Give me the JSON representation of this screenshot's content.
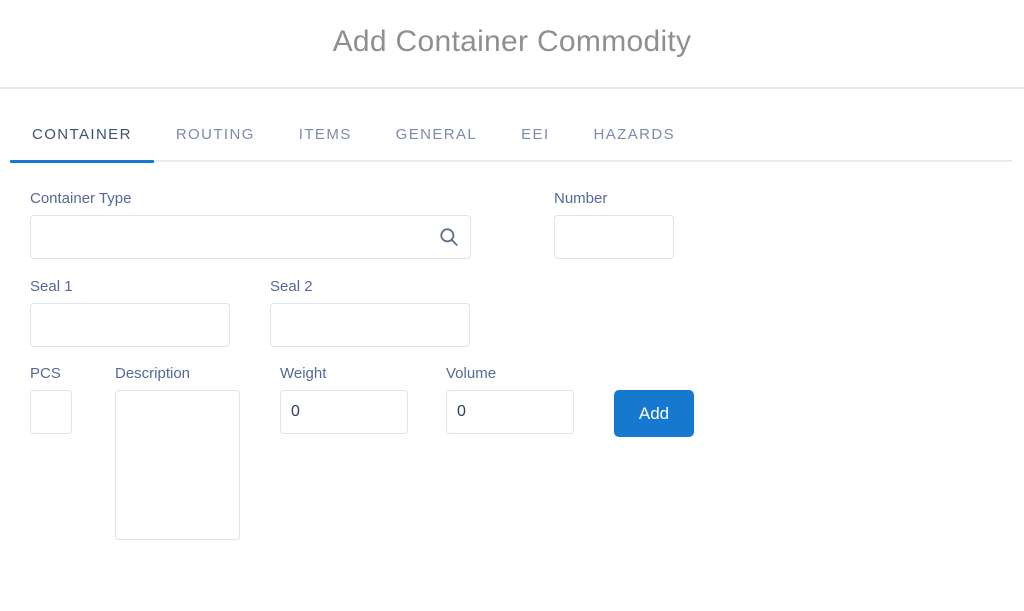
{
  "header": {
    "title": "Add Container Commodity"
  },
  "tabs": [
    {
      "label": "CONTAINER",
      "active": true
    },
    {
      "label": "ROUTING",
      "active": false
    },
    {
      "label": "ITEMS",
      "active": false
    },
    {
      "label": "GENERAL",
      "active": false
    },
    {
      "label": "EEI",
      "active": false
    },
    {
      "label": "HAZARDS",
      "active": false
    }
  ],
  "form": {
    "container_type": {
      "label": "Container Type",
      "value": "",
      "placeholder": "",
      "icon": "search-icon"
    },
    "number": {
      "label": "Number",
      "value": "",
      "placeholder": ""
    },
    "seal_1": {
      "label": "Seal 1",
      "value": "",
      "placeholder": ""
    },
    "seal_2": {
      "label": "Seal 2",
      "value": "",
      "placeholder": ""
    },
    "pcs": {
      "label": "PCS",
      "value": "",
      "placeholder": ""
    },
    "description": {
      "label": "Description",
      "value": "",
      "placeholder": ""
    },
    "weight": {
      "label": "Weight",
      "value": "0",
      "placeholder": ""
    },
    "volume": {
      "label": "Volume",
      "value": "0",
      "placeholder": ""
    },
    "add_button": {
      "label": "Add"
    }
  },
  "colors": {
    "accent_blue": "#1778cf",
    "label_slate": "#55689a",
    "tab_inactive": "#7b8bab",
    "tab_active": "#3d5273",
    "title_gray": "#8d8f92",
    "border": "#dde3ed",
    "value_text": "#2c3e5d"
  }
}
